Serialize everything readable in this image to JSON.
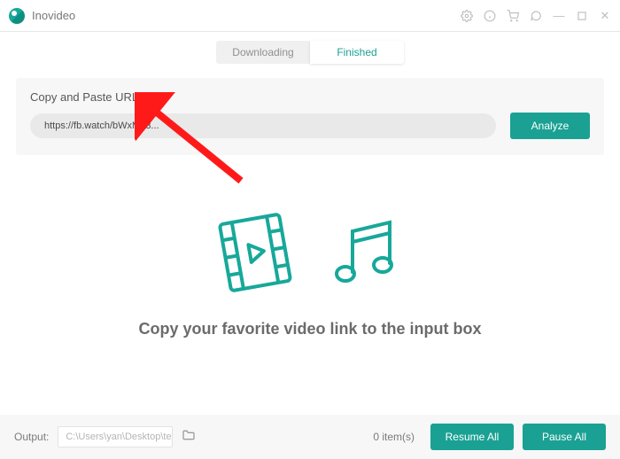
{
  "app": {
    "title": "Inovideo"
  },
  "tabs": {
    "downloading": "Downloading",
    "finished": "Finished"
  },
  "url_panel": {
    "label": "Copy and Paste URL here:",
    "value": "https://fb.watch/bWxM93...",
    "analyze": "Analyze"
  },
  "center_hint": "Copy your favorite video link to the input box",
  "bottom": {
    "output_label": "Output:",
    "output_path": "C:\\Users\\yan\\Desktop\\te...",
    "items": "0 item(s)",
    "resume": "Resume All",
    "pause": "Pause All"
  },
  "colors": {
    "accent": "#1aa193"
  }
}
